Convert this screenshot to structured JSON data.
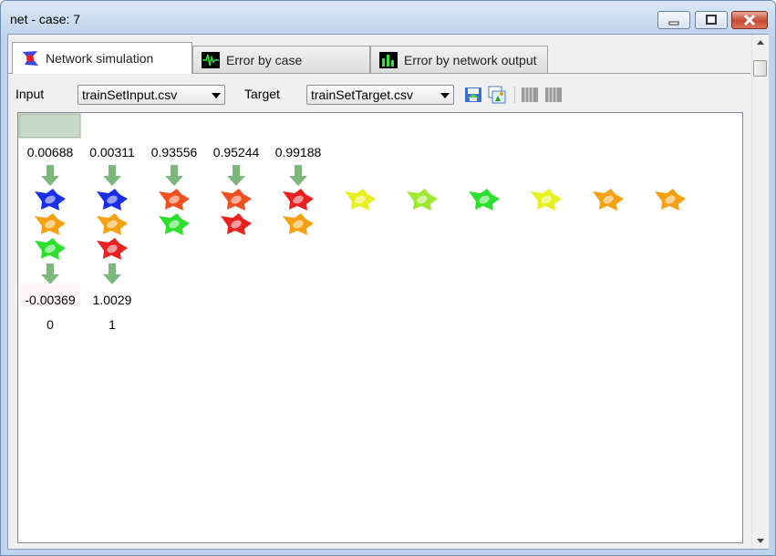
{
  "window": {
    "title": "net - case: 7"
  },
  "tabs": [
    {
      "label": "Network simulation",
      "icon": "network-icon",
      "active": true
    },
    {
      "label": "Error by case",
      "icon": "waveform-icon",
      "active": false
    },
    {
      "label": "Error by network output",
      "icon": "bar-meter-icon",
      "active": false
    }
  ],
  "toolbar": {
    "input_label": "Input",
    "input_value": "trainSetInput.csv",
    "target_label": "Target",
    "target_value": "trainSetTarget.csv"
  },
  "network": {
    "inputs": [
      "0.00688",
      "0.00311",
      "0.93556",
      "0.95244",
      "0.99188"
    ],
    "outputs": [
      "-0.00369",
      "1.0029"
    ],
    "targets": [
      "0",
      "1"
    ],
    "colors": {
      "blue": "#1a2ee8",
      "orange": "#f5a010",
      "green": "#2de02d",
      "red": "#e82020",
      "redorange": "#f05020",
      "yellow": "#e8f020",
      "lime": "#a0e830",
      "arrow": "#7cb87c"
    },
    "columns": [
      [
        "blue",
        "orange",
        "green"
      ],
      [
        "blue",
        "orange",
        "red"
      ],
      [
        "redorange",
        "green"
      ],
      [
        "redorange",
        "red"
      ],
      [
        "red",
        "orange"
      ],
      [
        "yellow"
      ],
      [
        "lime"
      ],
      [
        "green"
      ],
      [
        "yellow"
      ],
      [
        "orange"
      ],
      [
        "orange"
      ]
    ]
  }
}
